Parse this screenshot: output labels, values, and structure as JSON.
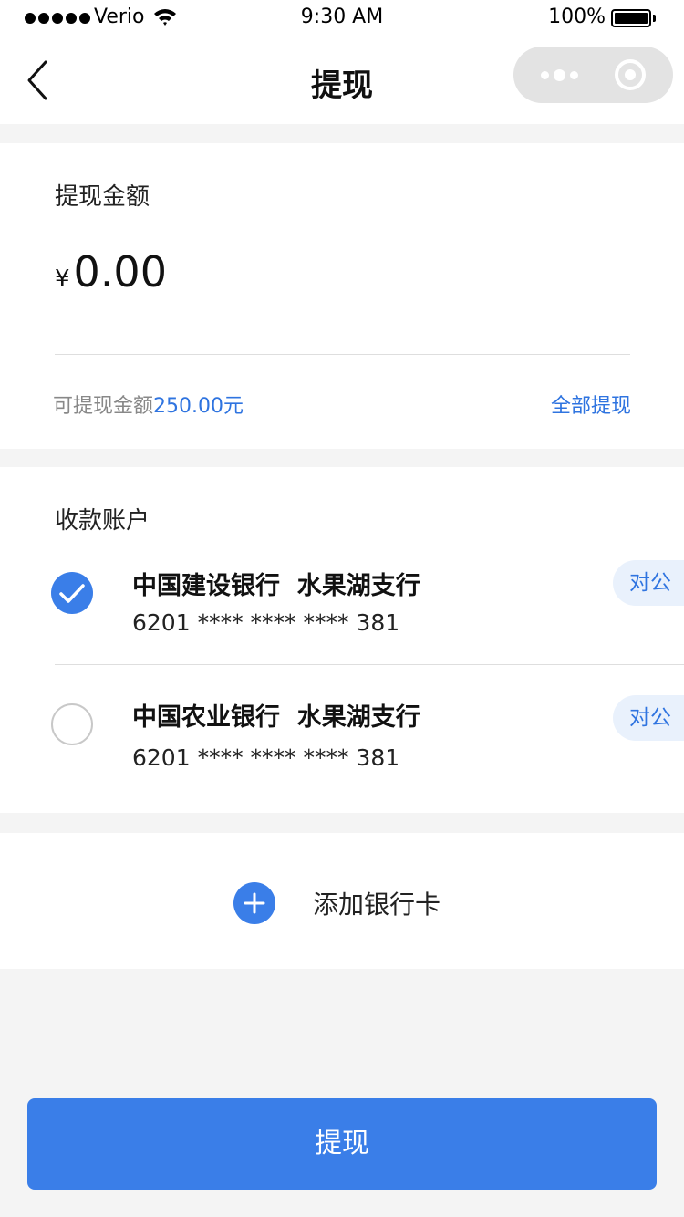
{
  "status_bar": {
    "carrier": "Verio",
    "time": "9:30 AM",
    "battery": "100%"
  },
  "nav": {
    "title": "提现"
  },
  "amount_section": {
    "label": "提现金额",
    "currency": "¥",
    "amount": "0.00",
    "available_prefix": "可提现金额",
    "available_value": "250.00元",
    "withdraw_all": "全部提现"
  },
  "accounts_section": {
    "label": "收款账户",
    "accounts": [
      {
        "bank": "中国建设银行  水果湖支行",
        "number": "6201 **** **** **** 381",
        "tag": "对公",
        "selected": true
      },
      {
        "bank": "中国农业银行  水果湖支行",
        "number": "6201 **** **** **** 381",
        "tag": "对公",
        "selected": false
      }
    ]
  },
  "add_card": {
    "label": "添加银行卡"
  },
  "submit": {
    "label": "提现"
  },
  "colors": {
    "accent": "#3a7ee8",
    "link": "#2f74e0",
    "background": "#f4f4f4",
    "badge_bg": "#e9f1fc"
  },
  "icons": [
    "wifi-icon",
    "battery-icon",
    "back-arrow-icon",
    "more-icon",
    "close-circle-icon",
    "check-icon",
    "plus-icon"
  ]
}
